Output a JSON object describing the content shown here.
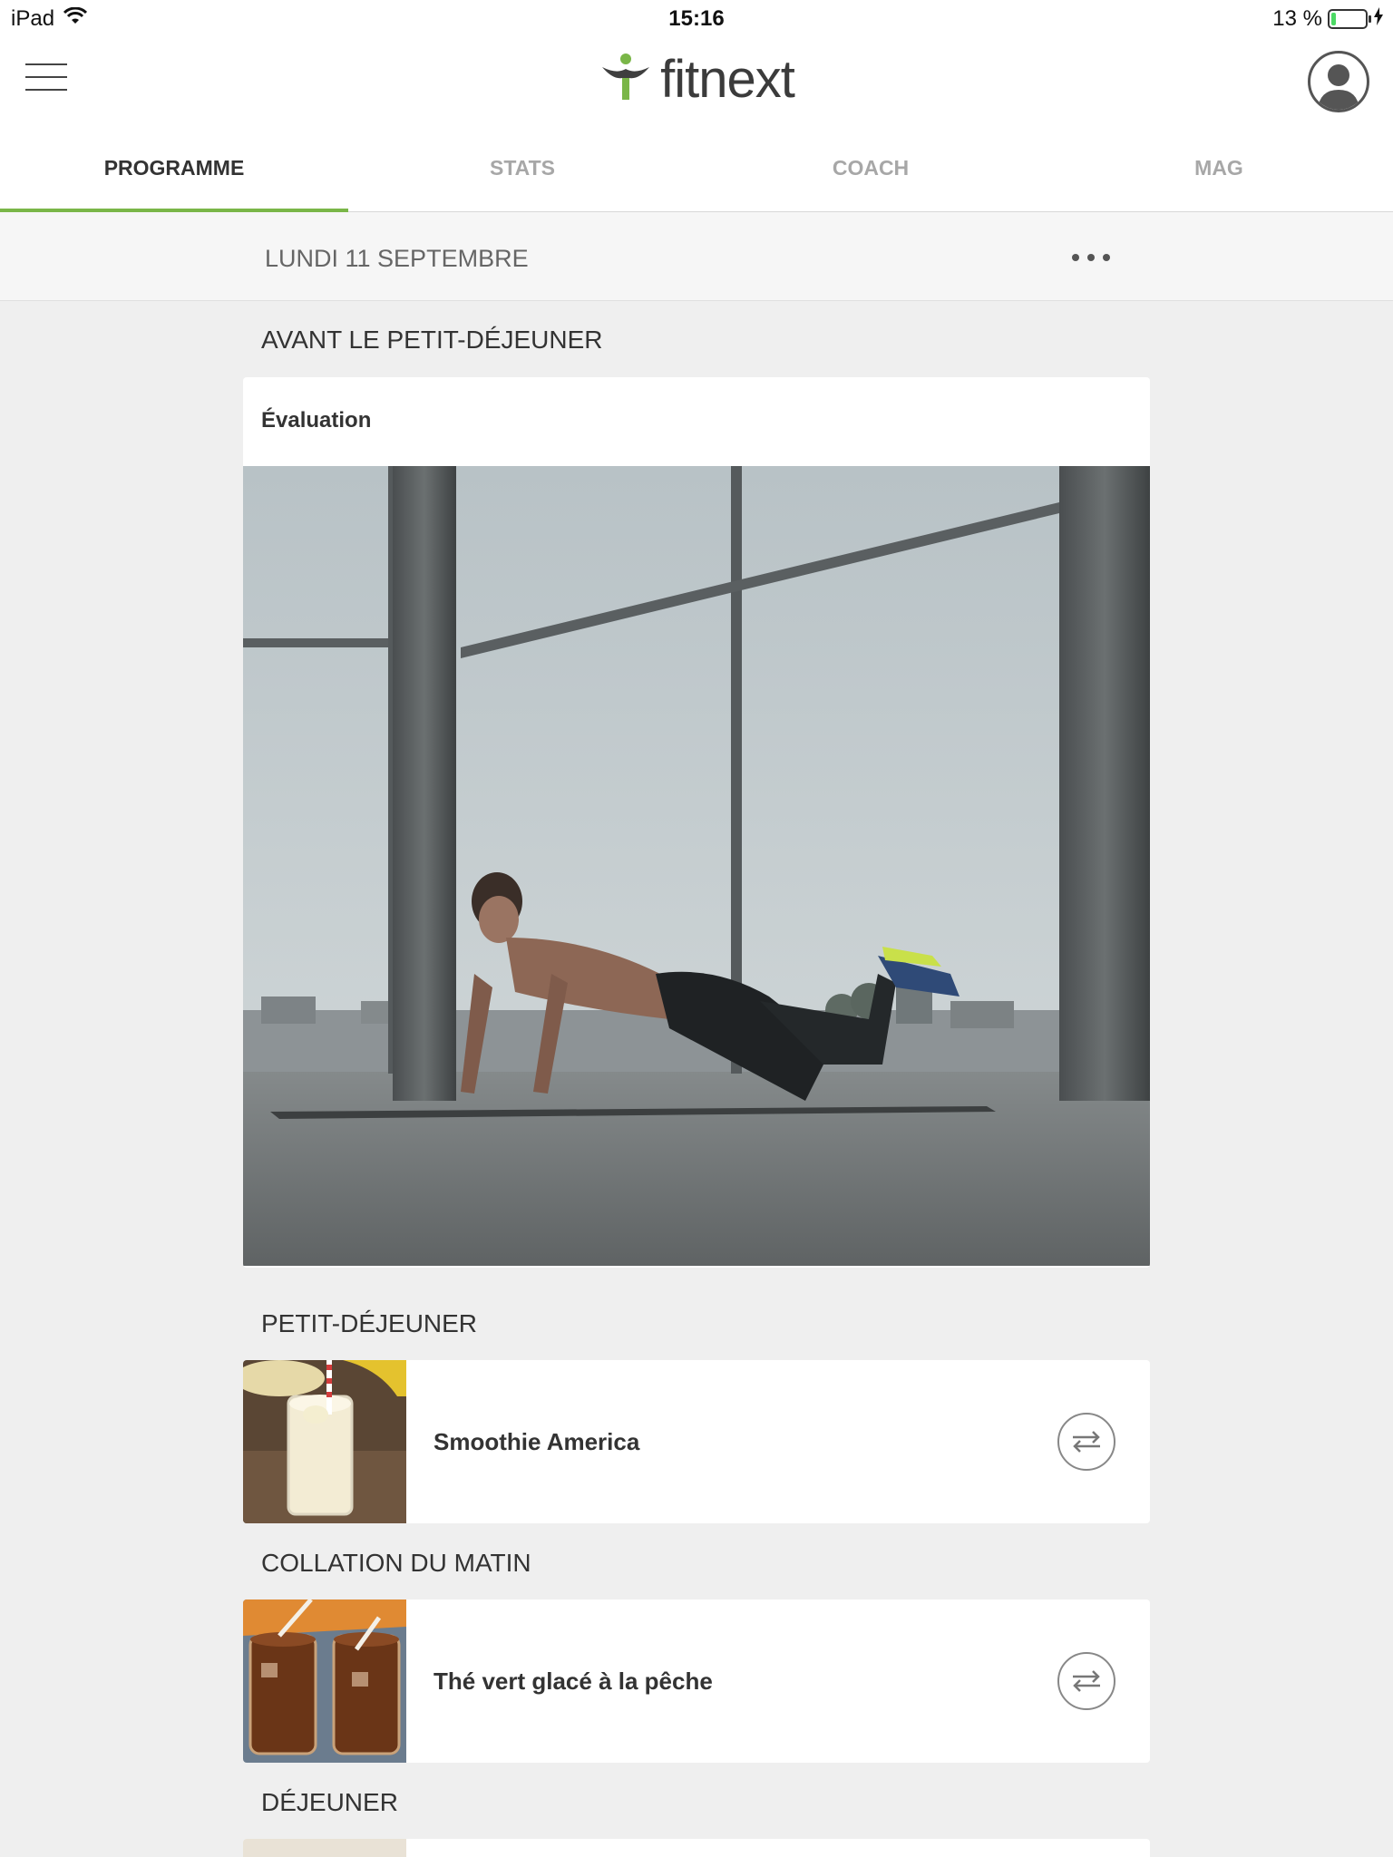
{
  "status_bar": {
    "device": "iPad",
    "time": "15:16",
    "battery": "13 %",
    "battery_level": 0.13,
    "icons": [
      "wifi-icon",
      "battery-icon",
      "charging-icon"
    ]
  },
  "header": {
    "logo_text": "fitnext",
    "brand_color": "#7ab648",
    "icons": [
      "menu-icon",
      "logo-figure-icon",
      "profile-avatar-icon"
    ]
  },
  "tabs": [
    {
      "label": "PROGRAMME",
      "active": true
    },
    {
      "label": "STATS",
      "active": false
    },
    {
      "label": "COACH",
      "active": false
    },
    {
      "label": "MAG",
      "active": false
    }
  ],
  "date_bar": {
    "date": "LUNDI 11 SEPTEMBRE",
    "icon": "more-options-icon"
  },
  "sections": {
    "before_breakfast": {
      "title": "AVANT LE PETIT-DÉJEUNER",
      "card_title": "Évaluation",
      "image": "push-up-photo"
    },
    "breakfast": {
      "title": "PETIT-DÉJEUNER",
      "meal": "Smoothie America",
      "image": "banana-smoothie-photo",
      "icon": "swap-icon"
    },
    "morning_snack": {
      "title": "COLLATION DU MATIN",
      "meal": "Thé vert glacé à la pêche",
      "image": "iced-tea-photo",
      "icon": "swap-icon"
    },
    "lunch": {
      "title": "DÉJEUNER"
    }
  }
}
